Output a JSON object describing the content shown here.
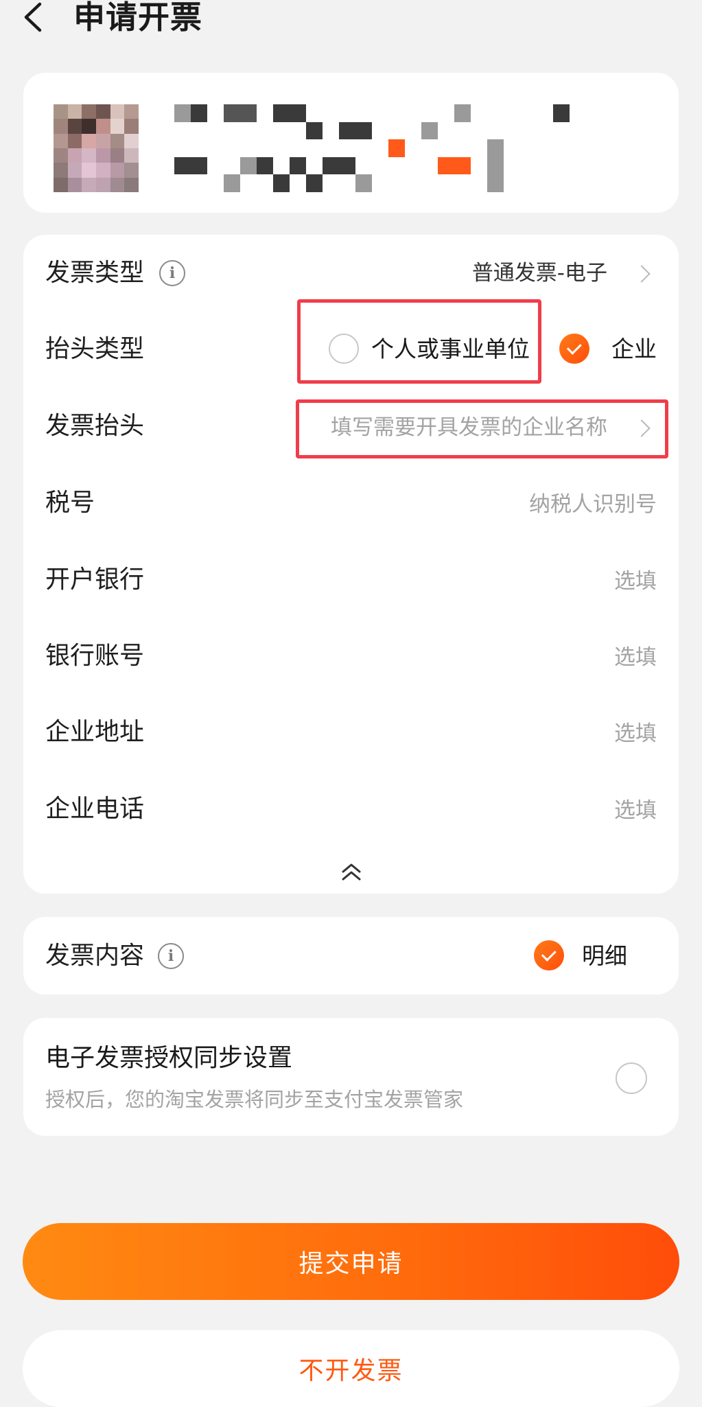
{
  "header": {
    "back_icon": "chevron-left-icon",
    "title": "申请开票"
  },
  "form": {
    "invoice_type": {
      "label": "发票类型",
      "value": "普通发票-电子"
    },
    "title_type": {
      "label": "抬头类型",
      "options": [
        {
          "label": "个人或事业单位",
          "selected": false
        },
        {
          "label": "企业",
          "selected": true
        }
      ]
    },
    "invoice_title": {
      "label": "发票抬头",
      "placeholder": "填写需要开具发票的企业名称"
    },
    "tax_id": {
      "label": "税号",
      "placeholder": "纳税人识别号"
    },
    "bank": {
      "label": "开户银行",
      "placeholder": "选填"
    },
    "bank_account": {
      "label": "银行账号",
      "placeholder": "选填"
    },
    "address": {
      "label": "企业地址",
      "placeholder": "选填"
    },
    "phone": {
      "label": "企业电话",
      "placeholder": "选填"
    },
    "collapse_icon": "double-chevron-up-icon"
  },
  "invoice_content": {
    "label": "发票内容",
    "option": "明细",
    "selected": true
  },
  "sync": {
    "title": "电子发票授权同步设置",
    "description": "授权后，您的淘宝发票将同步至支付宝发票管家",
    "enabled": false
  },
  "buttons": {
    "submit": "提交申请",
    "skip": "不开发票"
  },
  "colors": {
    "accent": "#ff6a0c",
    "highlight_box": "#f03d4a"
  }
}
